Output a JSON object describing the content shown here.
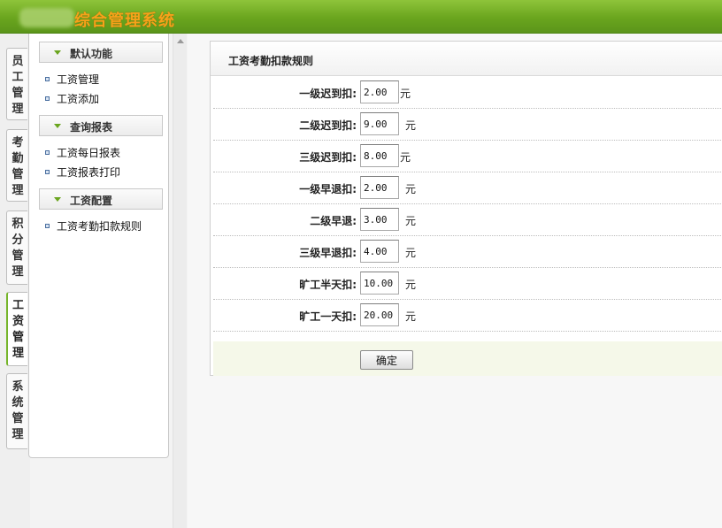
{
  "header": {
    "app_title": "综合管理系统"
  },
  "vtabs": [
    {
      "label": "员工管理"
    },
    {
      "label": "考勤管理"
    },
    {
      "label": "积分管理"
    },
    {
      "label": "工资管理"
    },
    {
      "label": "系统管理"
    }
  ],
  "menu": {
    "sections": [
      {
        "title": "默认功能",
        "items": [
          "工资管理",
          "工资添加"
        ]
      },
      {
        "title": "查询报表",
        "items": [
          "工资每日报表",
          "工资报表打印"
        ]
      },
      {
        "title": "工资配置",
        "items": [
          "工资考勤扣款规则"
        ]
      }
    ]
  },
  "form": {
    "title": "工资考勤扣款规则",
    "rows": [
      {
        "label": "一级迟到扣:",
        "value": "2.00",
        "unit": "元"
      },
      {
        "label": "二级迟到扣:",
        "value": "9.00",
        "unit": "元"
      },
      {
        "label": "三级迟到扣:",
        "value": "8.00",
        "unit": "元"
      },
      {
        "label": "一级早退扣:",
        "value": "2.00",
        "unit": "元"
      },
      {
        "label": "二级早退:",
        "value": "3.00",
        "unit": "元"
      },
      {
        "label": "三级早退扣:",
        "value": "4.00",
        "unit": "元"
      },
      {
        "label": "旷工半天扣:",
        "value": "10.00",
        "unit": "元"
      },
      {
        "label": "旷工一天扣:",
        "value": "20.00",
        "unit": "元"
      }
    ],
    "submit_label": "确定"
  },
  "colors": {
    "header_green": "#6aa51e",
    "title_orange": "#f6a21a"
  }
}
